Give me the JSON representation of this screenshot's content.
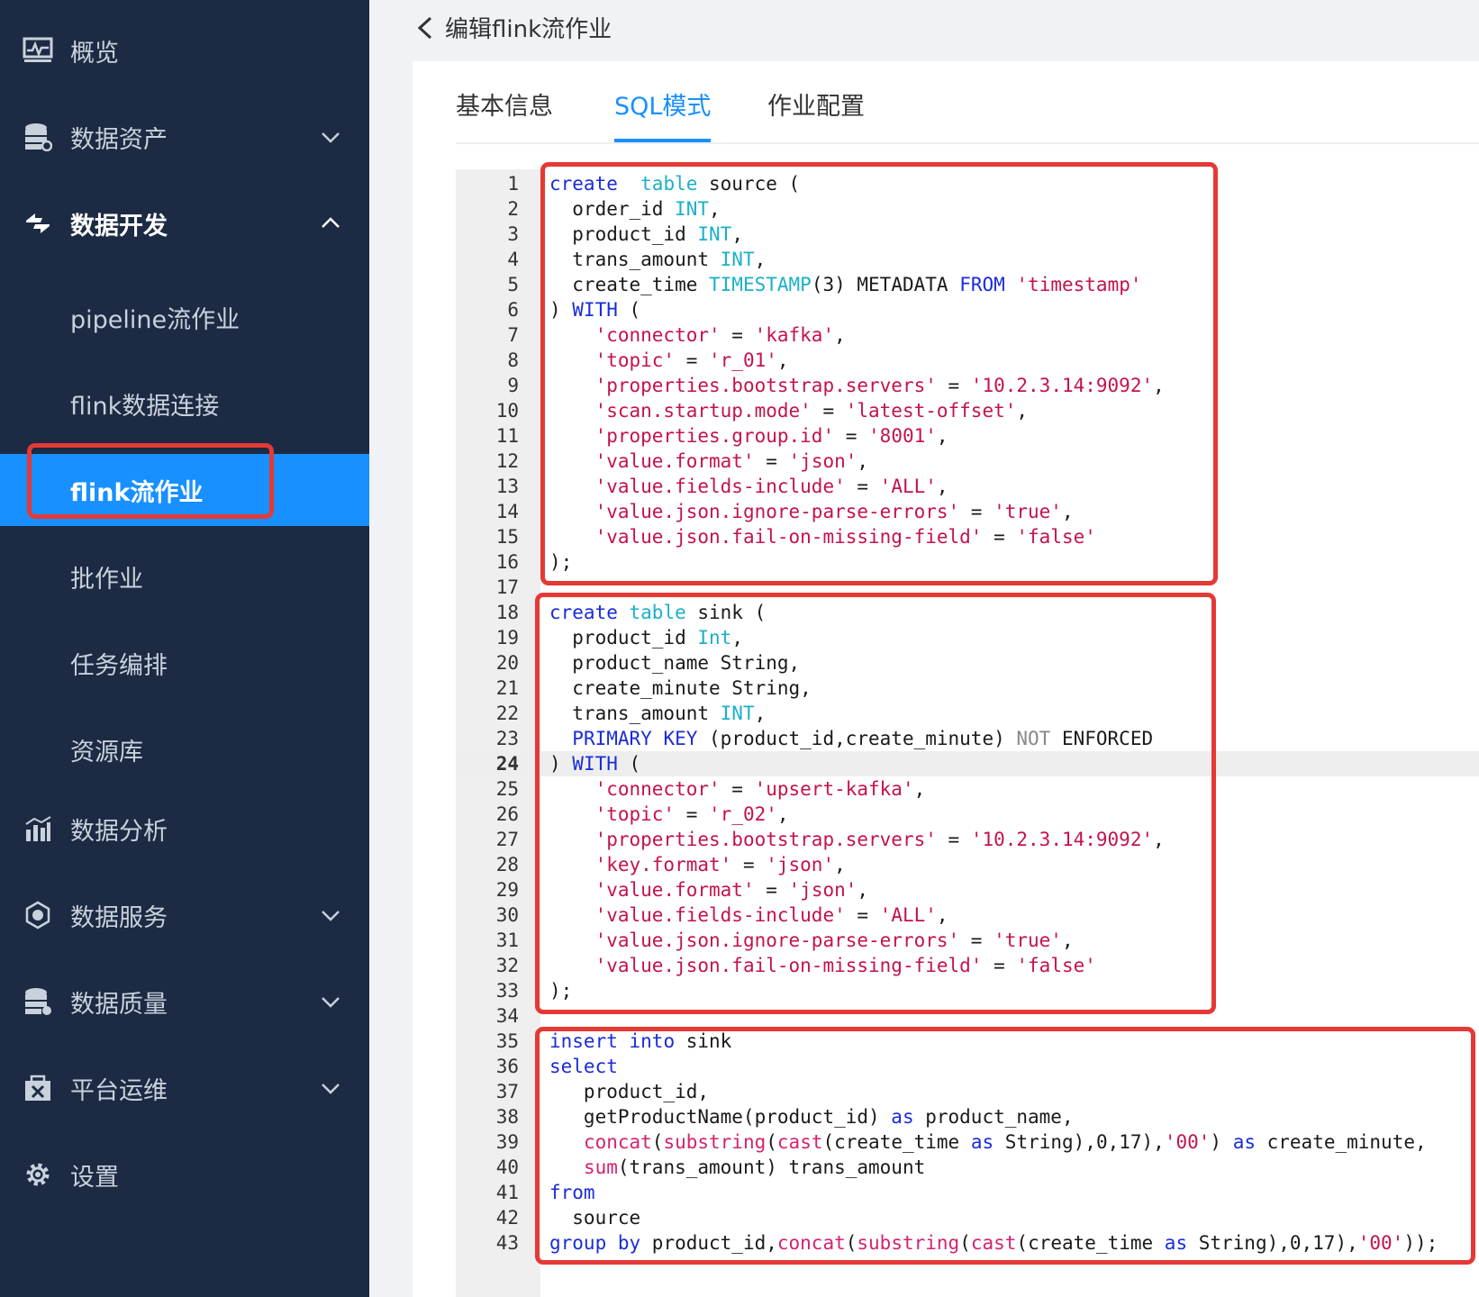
{
  "sidebar": {
    "items": [
      {
        "label": "概览",
        "icon": "dashboard-icon"
      },
      {
        "label": "数据资产",
        "icon": "database-icon",
        "expanded": false
      },
      {
        "label": "数据开发",
        "icon": "dev-icon",
        "expanded": true
      },
      {
        "label": "数据分析",
        "icon": "analytics-icon"
      },
      {
        "label": "数据服务",
        "icon": "service-icon",
        "expanded": false
      },
      {
        "label": "数据质量",
        "icon": "quality-icon",
        "expanded": false
      },
      {
        "label": "平台运维",
        "icon": "ops-icon",
        "expanded": false
      },
      {
        "label": "设置",
        "icon": "gear-icon"
      }
    ],
    "sub_items": [
      {
        "label": "pipeline流作业"
      },
      {
        "label": "flink数据连接"
      },
      {
        "label": "flink流作业",
        "active": true
      },
      {
        "label": "批作业"
      },
      {
        "label": "任务编排"
      },
      {
        "label": "资源库"
      }
    ]
  },
  "header": {
    "title": "编辑flink流作业"
  },
  "tabs": [
    {
      "label": "基本信息"
    },
    {
      "label": "SQL模式",
      "active": true
    },
    {
      "label": "作业配置"
    }
  ],
  "editor": {
    "current_line": 24,
    "lines": [
      [
        [
          "kw",
          "create"
        ],
        [
          "",
          "  "
        ],
        [
          "ty",
          "table"
        ],
        [
          "",
          " source ("
        ]
      ],
      [
        [
          "",
          "  order_id "
        ],
        [
          "ty",
          "INT"
        ],
        [
          "",
          ","
        ]
      ],
      [
        [
          "",
          "  product_id "
        ],
        [
          "ty",
          "INT"
        ],
        [
          "",
          ","
        ]
      ],
      [
        [
          "",
          "  trans_amount "
        ],
        [
          "ty",
          "INT"
        ],
        [
          "",
          ","
        ]
      ],
      [
        [
          "",
          "  create_time "
        ],
        [
          "ty",
          "TIMESTAMP"
        ],
        [
          "",
          "(3) METADATA "
        ],
        [
          "kw",
          "FROM"
        ],
        [
          "",
          " "
        ],
        [
          "st",
          "'timestamp'"
        ]
      ],
      [
        [
          "",
          ") "
        ],
        [
          "kw",
          "WITH"
        ],
        [
          "",
          " ("
        ]
      ],
      [
        [
          "",
          "    "
        ],
        [
          "st",
          "'connector'"
        ],
        [
          "",
          " = "
        ],
        [
          "st",
          "'kafka'"
        ],
        [
          "",
          ","
        ]
      ],
      [
        [
          "",
          "    "
        ],
        [
          "st",
          "'topic'"
        ],
        [
          "",
          " = "
        ],
        [
          "st",
          "'r_01'"
        ],
        [
          "",
          ","
        ]
      ],
      [
        [
          "",
          "    "
        ],
        [
          "st",
          "'properties.bootstrap.servers'"
        ],
        [
          "",
          " = "
        ],
        [
          "st",
          "'10.2.3.14:9092'"
        ],
        [
          "",
          ","
        ]
      ],
      [
        [
          "",
          "    "
        ],
        [
          "st",
          "'scan.startup.mode'"
        ],
        [
          "",
          " = "
        ],
        [
          "st",
          "'latest-offset'"
        ],
        [
          "",
          ","
        ]
      ],
      [
        [
          "",
          "    "
        ],
        [
          "st",
          "'properties.group.id'"
        ],
        [
          "",
          " = "
        ],
        [
          "st",
          "'8001'"
        ],
        [
          "",
          ","
        ]
      ],
      [
        [
          "",
          "    "
        ],
        [
          "st",
          "'value.format'"
        ],
        [
          "",
          " = "
        ],
        [
          "st",
          "'json'"
        ],
        [
          "",
          ","
        ]
      ],
      [
        [
          "",
          "    "
        ],
        [
          "st",
          "'value.fields-include'"
        ],
        [
          "",
          " = "
        ],
        [
          "st",
          "'ALL'"
        ],
        [
          "",
          ","
        ]
      ],
      [
        [
          "",
          "    "
        ],
        [
          "st",
          "'value.json.ignore-parse-errors'"
        ],
        [
          "",
          " = "
        ],
        [
          "st",
          "'true'"
        ],
        [
          "",
          ","
        ]
      ],
      [
        [
          "",
          "    "
        ],
        [
          "st",
          "'value.json.fail-on-missing-field'"
        ],
        [
          "",
          " = "
        ],
        [
          "st",
          "'false'"
        ]
      ],
      [
        [
          "",
          ");"
        ]
      ],
      [
        [
          "",
          ""
        ]
      ],
      [
        [
          "kw",
          "create"
        ],
        [
          "",
          " "
        ],
        [
          "ty",
          "table"
        ],
        [
          "",
          " sink ("
        ]
      ],
      [
        [
          "",
          "  product_id "
        ],
        [
          "ty",
          "Int"
        ],
        [
          "",
          ","
        ]
      ],
      [
        [
          "",
          "  product_name String,"
        ]
      ],
      [
        [
          "",
          "  create_minute String,"
        ]
      ],
      [
        [
          "",
          "  trans_amount "
        ],
        [
          "ty",
          "INT"
        ],
        [
          "",
          ","
        ]
      ],
      [
        [
          "",
          "  "
        ],
        [
          "kw",
          "PRIMARY KEY"
        ],
        [
          "",
          " (product_id,create_minute) "
        ],
        [
          "gr",
          "NOT"
        ],
        [
          "",
          " ENFORCED"
        ]
      ],
      [
        [
          "",
          ") "
        ],
        [
          "kw",
          "WITH"
        ],
        [
          "",
          " ("
        ]
      ],
      [
        [
          "",
          "    "
        ],
        [
          "st",
          "'connector'"
        ],
        [
          "",
          " = "
        ],
        [
          "st",
          "'upsert-kafka'"
        ],
        [
          "",
          ","
        ]
      ],
      [
        [
          "",
          "    "
        ],
        [
          "st",
          "'topic'"
        ],
        [
          "",
          " = "
        ],
        [
          "st",
          "'r_02'"
        ],
        [
          "",
          ","
        ]
      ],
      [
        [
          "",
          "    "
        ],
        [
          "st",
          "'properties.bootstrap.servers'"
        ],
        [
          "",
          " = "
        ],
        [
          "st",
          "'10.2.3.14:9092'"
        ],
        [
          "",
          ","
        ]
      ],
      [
        [
          "",
          "    "
        ],
        [
          "st",
          "'key.format'"
        ],
        [
          "",
          " = "
        ],
        [
          "st",
          "'json'"
        ],
        [
          "",
          ","
        ]
      ],
      [
        [
          "",
          "    "
        ],
        [
          "st",
          "'value.format'"
        ],
        [
          "",
          " = "
        ],
        [
          "st",
          "'json'"
        ],
        [
          "",
          ","
        ]
      ],
      [
        [
          "",
          "    "
        ],
        [
          "st",
          "'value.fields-include'"
        ],
        [
          "",
          " = "
        ],
        [
          "st",
          "'ALL'"
        ],
        [
          "",
          ","
        ]
      ],
      [
        [
          "",
          "    "
        ],
        [
          "st",
          "'value.json.ignore-parse-errors'"
        ],
        [
          "",
          " = "
        ],
        [
          "st",
          "'true'"
        ],
        [
          "",
          ","
        ]
      ],
      [
        [
          "",
          "    "
        ],
        [
          "st",
          "'value.json.fail-on-missing-field'"
        ],
        [
          "",
          " = "
        ],
        [
          "st",
          "'false'"
        ]
      ],
      [
        [
          "",
          ");"
        ]
      ],
      [
        [
          "",
          ""
        ]
      ],
      [
        [
          "kw",
          "insert"
        ],
        [
          "",
          " "
        ],
        [
          "kw",
          "into"
        ],
        [
          "",
          " sink"
        ]
      ],
      [
        [
          "kw",
          "select"
        ]
      ],
      [
        [
          "",
          "   product_id,"
        ]
      ],
      [
        [
          "",
          "   getProductName(product_id) "
        ],
        [
          "kw",
          "as"
        ],
        [
          "",
          " product_name,"
        ]
      ],
      [
        [
          "",
          "   "
        ],
        [
          "fn",
          "concat"
        ],
        [
          "",
          "("
        ],
        [
          "fn",
          "substring"
        ],
        [
          "",
          "("
        ],
        [
          "fn",
          "cast"
        ],
        [
          "",
          "(create_time "
        ],
        [
          "kw",
          "as"
        ],
        [
          "",
          " String),0,17),"
        ],
        [
          "st",
          "'00'"
        ],
        [
          "",
          ") "
        ],
        [
          "kw",
          "as"
        ],
        [
          "",
          " create_minute,"
        ]
      ],
      [
        [
          "",
          "   "
        ],
        [
          "fn",
          "sum"
        ],
        [
          "",
          "(trans_amount) trans_amount"
        ]
      ],
      [
        [
          "kw",
          "from"
        ]
      ],
      [
        [
          "",
          "  source"
        ]
      ],
      [
        [
          "kw",
          "group by"
        ],
        [
          "",
          " product_id,"
        ],
        [
          "fn",
          "concat"
        ],
        [
          "",
          "("
        ],
        [
          "fn",
          "substring"
        ],
        [
          "",
          "("
        ],
        [
          "fn",
          "cast"
        ],
        [
          "",
          "(create_time "
        ],
        [
          "kw",
          "as"
        ],
        [
          "",
          " String),0,17),"
        ],
        [
          "st",
          "'00'"
        ],
        [
          "",
          "));"
        ]
      ]
    ]
  }
}
